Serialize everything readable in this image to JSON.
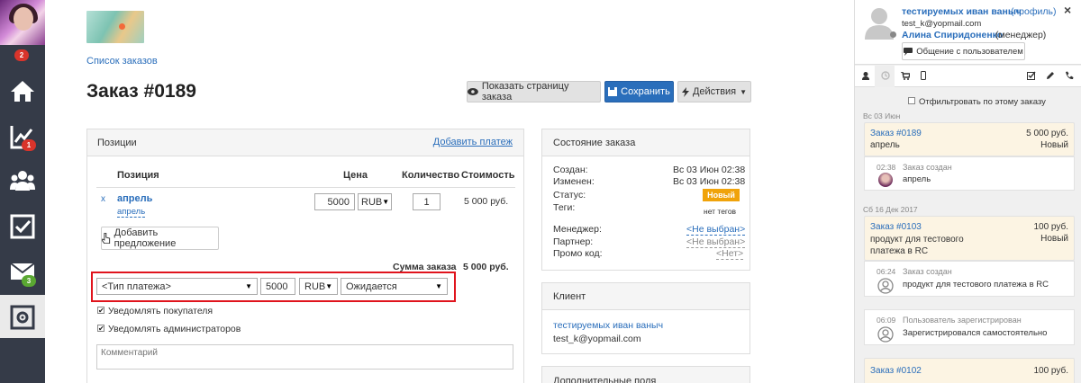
{
  "nav": {
    "badges": {
      "top": "2",
      "reports": "1",
      "messages": "3"
    },
    "colors": {
      "sidebar": "#353b48",
      "badge_red": "#d9342b",
      "badge_green": "#5aa832"
    }
  },
  "breadcrumb": "Список заказов",
  "order": {
    "title": "Заказ #0189",
    "buttons": {
      "show_page": "Показать страницу заказа",
      "save": "Сохранить",
      "actions": "Действия"
    }
  },
  "positions": {
    "title": "Позиции",
    "add_payment": "Добавить платеж",
    "columns": {
      "item": "Позиция",
      "price": "Цена",
      "qty": "Количество",
      "cost": "Стоимость"
    },
    "rows": [
      {
        "remove": "x",
        "name": "апрель",
        "variant": "апрель",
        "price": "5000",
        "currency": "RUB",
        "qty": "1",
        "cost": "5 000 руб."
      }
    ],
    "add_offer": "Добавить предложение",
    "total_label": "Сумма заказа",
    "total_value": "5 000 руб.",
    "payment": {
      "type_placeholder": "<Тип платежа>",
      "amount": "5000",
      "currency": "RUB",
      "status": "Ожидается"
    },
    "notify_customer": "Уведомлять покупателя",
    "notify_admins": "Уведомлять администраторов",
    "comment_placeholder": "Комментарий"
  },
  "order_state": {
    "title": "Состояние заказа",
    "created_label": "Создан:",
    "created_value": "Вс 03 Июн 02:38",
    "changed_label": "Изменен:",
    "changed_value": "Вс 03 Июн 02:38",
    "status_label": "Статус:",
    "status_value": "Новый",
    "tags_label": "Теги:",
    "tags_value": "нет тегов",
    "manager_label": "Менеджер:",
    "manager_value": "<Не выбран>",
    "partner_label": "Партнер:",
    "partner_value": "<Не выбран>",
    "promo_label": "Промо код:",
    "promo_value": "<Нет>",
    "status_color": "#f0a30a"
  },
  "client": {
    "title": "Клиент",
    "name": "тестируемых иван ваныч",
    "email": "test_k@yopmail.com"
  },
  "extra_fields": {
    "title": "Дополнительные поля"
  },
  "profile": {
    "name": "тестируемых иван ваныч",
    "profile_link": "(профиль)",
    "email": "test_k@yopmail.com",
    "manager_name": "Алина Спиридоненко",
    "manager_role": "(менеджер)",
    "chat_button": "Общение с пользователем",
    "close": "×"
  },
  "feed": {
    "filter_label": "Отфильтровать по этому заказу",
    "groups": [
      {
        "date": "Вс 03 Июн",
        "order": {
          "title": "Заказ #0189",
          "amount": "5 000 руб.",
          "desc": "апрель",
          "status": "Новый"
        },
        "events": [
          {
            "time": "02:38",
            "title": "Заказ создан",
            "text": "апрель"
          }
        ]
      },
      {
        "date": "Сб 16 Дек 2017",
        "order": {
          "title": "Заказ #0103",
          "amount": "100 руб.",
          "desc": "продукт для тестового платежа в RC",
          "status": "Новый"
        },
        "events": [
          {
            "time": "06:24",
            "title": "Заказ создан",
            "text": "продукт для тестового платежа в RC"
          },
          {
            "time": "06:09",
            "title": "Пользователь зарегистрирован",
            "text": "Зарегистрировался самостоятельно"
          }
        ]
      }
    ],
    "last_order": {
      "title": "Заказ #0102",
      "amount": "100 руб."
    }
  }
}
